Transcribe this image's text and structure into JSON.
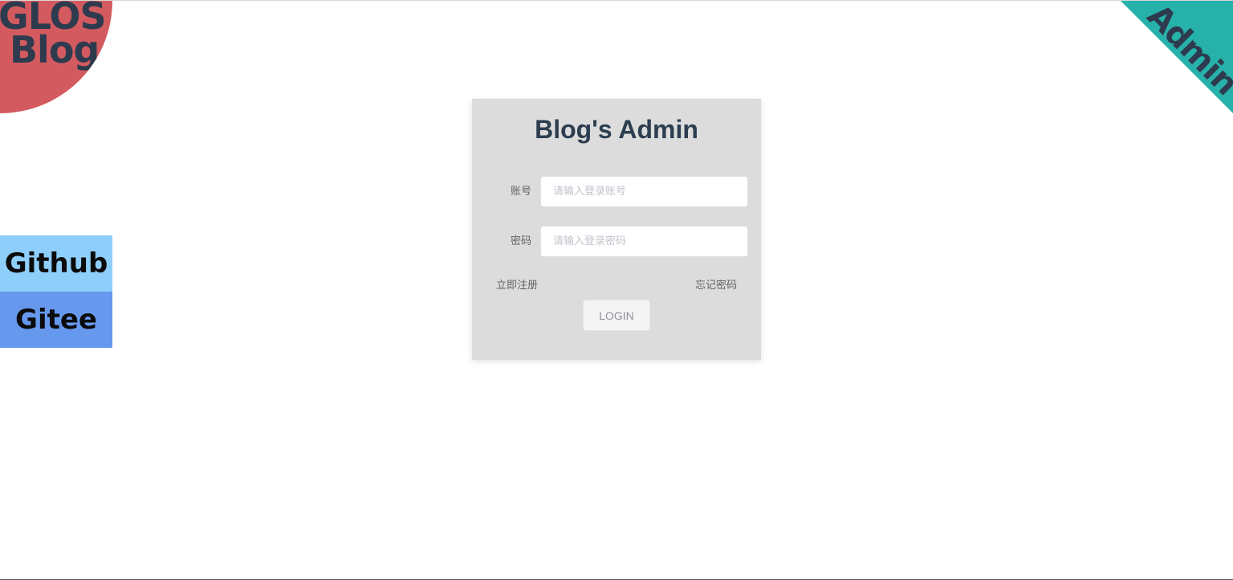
{
  "logo": {
    "line1": "GLOS",
    "line2": "Blog"
  },
  "corner": {
    "label": "Admin"
  },
  "side_links": {
    "github": "Github",
    "gitee": "Gitee"
  },
  "login": {
    "title": "Blog's Admin",
    "account_label": "账号",
    "account_placeholder": "请输入登录账号",
    "account_value": "",
    "password_label": "密码",
    "password_placeholder": "请输入登录密码",
    "password_value": "",
    "register_link": "立即注册",
    "forgot_link": "忘记密码",
    "submit_label": "LOGIN"
  },
  "colors": {
    "logo_bg": "#d35b5f",
    "corner_bg": "#26b2aa",
    "github_bg": "#8ecefb",
    "gitee_bg": "#6699ee",
    "card_bg": "#dcdcdc",
    "title_text": "#2c3e50"
  }
}
